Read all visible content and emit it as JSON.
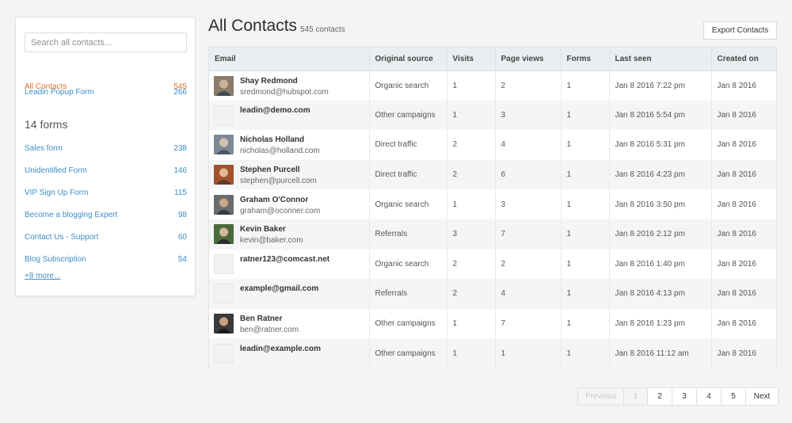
{
  "sidebar": {
    "search_placeholder": "Search all contacts...",
    "all_contacts": {
      "label": "All Contacts",
      "count": "545"
    },
    "popup_form": {
      "label": "Leadin Popup Form",
      "count": "266"
    },
    "forms_heading": "14 forms",
    "forms": [
      {
        "label": "Sales form",
        "count": "238"
      },
      {
        "label": "Unidentified Form",
        "count": "146"
      },
      {
        "label": "VIP Sign Up Form",
        "count": "115"
      },
      {
        "label": "Become a blogging Expert",
        "count": "98"
      },
      {
        "label": "Contact Us - Support",
        "count": "60"
      },
      {
        "label": "Blog Subscription",
        "count": "54"
      }
    ],
    "more_link": "+8 more..."
  },
  "header": {
    "title": "All Contacts",
    "count": "545 contacts",
    "export_label": "Export Contacts"
  },
  "table": {
    "columns": [
      "Email",
      "Original source",
      "Visits",
      "Page views",
      "Forms",
      "Last seen",
      "Created on"
    ],
    "rows": [
      {
        "name": "Shay Redmond",
        "email": "sredmond@hubspot.com",
        "source": "Organic search",
        "visits": "1",
        "page_views": "2",
        "forms": "1",
        "last_seen": "Jan 8 2016 7:22 pm",
        "created": "Jan 8 2016"
      },
      {
        "name": "",
        "email": "leadin@demo.com",
        "source": "Other campaigns",
        "visits": "1",
        "page_views": "3",
        "forms": "1",
        "last_seen": "Jan 8 2016 5:54 pm",
        "created": "Jan 8 2016"
      },
      {
        "name": "Nicholas Holland",
        "email": "nicholas@holland.com",
        "source": "Direct traffic",
        "visits": "2",
        "page_views": "4",
        "forms": "1",
        "last_seen": "Jan 8 2016 5:31 pm",
        "created": "Jan 8 2016"
      },
      {
        "name": "Stephen Purcell",
        "email": "stephen@purcell.com",
        "source": "Direct traffic",
        "visits": "2",
        "page_views": "6",
        "forms": "1",
        "last_seen": "Jan 8 2016 4:23 pm",
        "created": "Jan 8 2016"
      },
      {
        "name": "Graham O'Connor",
        "email": "graham@oconner.com",
        "source": "Organic search",
        "visits": "1",
        "page_views": "3",
        "forms": "1",
        "last_seen": "Jan 8 2016 3:50 pm",
        "created": "Jan 8 2016"
      },
      {
        "name": "Kevin Baker",
        "email": "kevin@baker.com",
        "source": "Referrals",
        "visits": "3",
        "page_views": "7",
        "forms": "1",
        "last_seen": "Jan 8 2016 2:12 pm",
        "created": "Jan 8 2016"
      },
      {
        "name": "",
        "email": "ratner123@comcast.net",
        "source": "Organic search",
        "visits": "2",
        "page_views": "2",
        "forms": "1",
        "last_seen": "Jan 8 2016 1:40 pm",
        "created": "Jan 8 2016"
      },
      {
        "name": "",
        "email": "example@gmail.com",
        "source": "Referrals",
        "visits": "2",
        "page_views": "4",
        "forms": "1",
        "last_seen": "Jan 8 2016 4:13 pm",
        "created": "Jan 8 2016"
      },
      {
        "name": "Ben Ratner",
        "email": "ben@ratner.com",
        "source": "Other campaigns",
        "visits": "1",
        "page_views": "7",
        "forms": "1",
        "last_seen": "Jan 8 2016 1:23 pm",
        "created": "Jan 8 2016"
      },
      {
        "name": "",
        "email": "leadin@example.com",
        "source": "Other campaigns",
        "visits": "1",
        "page_views": "1",
        "forms": "1",
        "last_seen": "Jan 8 2016 11:12 am",
        "created": "Jan 8 2016"
      }
    ]
  },
  "pagination": {
    "previous": "Previous",
    "pages": [
      "1",
      "2",
      "3",
      "4",
      "5"
    ],
    "next": "Next"
  },
  "colors": {
    "active": "#e8702a",
    "link": "#3d8ec7"
  }
}
